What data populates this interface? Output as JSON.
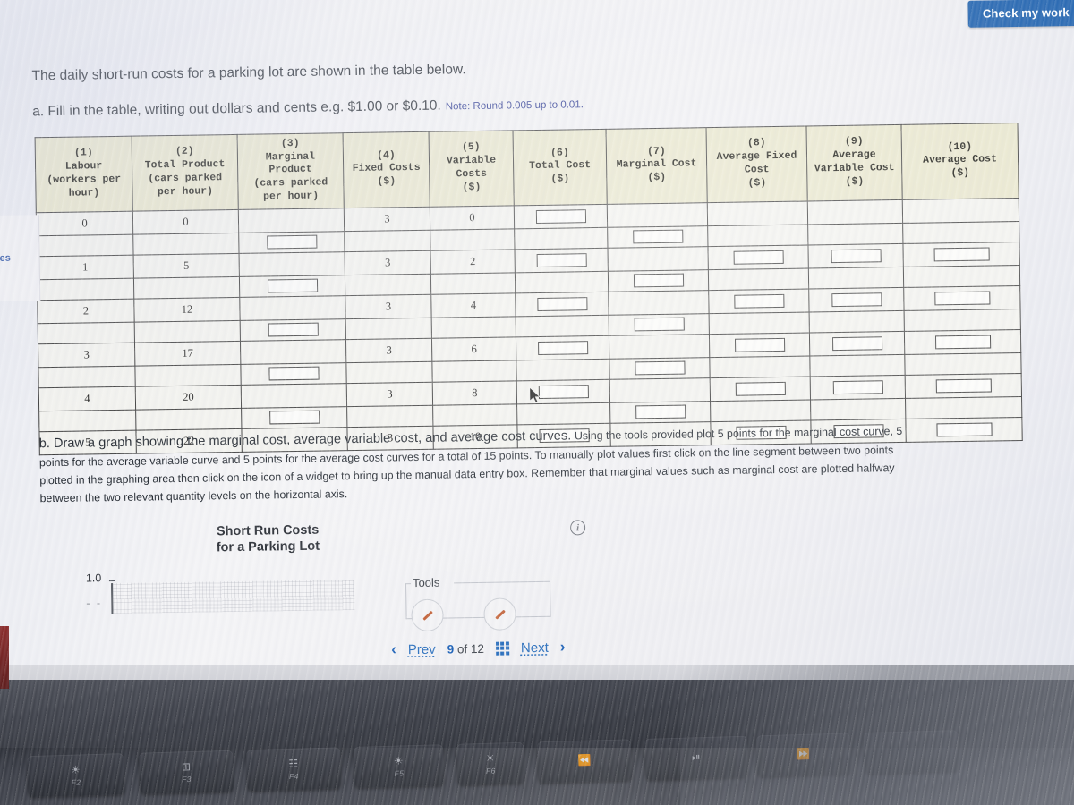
{
  "toolbar": {
    "check_my_work": "Check my work"
  },
  "left_edge_fragment": "es",
  "prompt": {
    "line1": "The daily short-run costs for a parking lot are shown in the table below.",
    "line2": "a.  Fill in the table, writing out dollars and cents e.g. $1.00 or $0.10.",
    "note": "Note: Round 0.005 up to 0.01."
  },
  "table": {
    "headers": [
      {
        "num": "(1)",
        "label": "Labour\n(workers per\nhour)"
      },
      {
        "num": "(2)",
        "label": "Total Product\n(cars parked\nper hour)"
      },
      {
        "num": "(3)",
        "label": "Marginal\nProduct\n(cars parked\nper hour)"
      },
      {
        "num": "(4)",
        "label": "Fixed Costs\n($)"
      },
      {
        "num": "(5)",
        "label": "Variable\nCosts\n($)"
      },
      {
        "num": "(6)",
        "label": "Total Cost\n($)"
      },
      {
        "num": "(7)",
        "label": "Marginal Cost\n($)"
      },
      {
        "num": "(8)",
        "label": "Average Fixed\nCost\n($)"
      },
      {
        "num": "(9)",
        "label": "Average\nVariable Cost\n($)"
      },
      {
        "num": "(10)",
        "label": "Average Cost\n($)"
      }
    ],
    "rows": [
      {
        "labour": "0",
        "total_product": "0",
        "fixed_costs": "3",
        "variable_costs": "0"
      },
      {
        "labour": "1",
        "total_product": "5",
        "fixed_costs": "3",
        "variable_costs": "2"
      },
      {
        "labour": "2",
        "total_product": "12",
        "fixed_costs": "3",
        "variable_costs": "4"
      },
      {
        "labour": "3",
        "total_product": "17",
        "fixed_costs": "3",
        "variable_costs": "6"
      },
      {
        "labour": "4",
        "total_product": "20",
        "fixed_costs": "3",
        "variable_costs": "8"
      },
      {
        "labour": "5",
        "total_product": "22",
        "fixed_costs": "3",
        "variable_costs": "10"
      }
    ],
    "marginal_product_inputs": [
      "",
      "",
      "",
      "",
      ""
    ],
    "total_cost_inputs": [
      "",
      "",
      "",
      "",
      "",
      ""
    ],
    "marginal_cost_inputs": [
      "",
      "",
      "",
      "",
      ""
    ],
    "average_fixed_cost_inputs": [
      "",
      "",
      "",
      "",
      ""
    ],
    "average_variable_cost_inputs": [
      "",
      "",
      "",
      "",
      ""
    ],
    "average_cost_inputs": [
      "",
      "",
      "",
      "",
      ""
    ]
  },
  "part_b": {
    "lead": "b. Draw a graph showing the marginal cost, average variable cost, and average cost curves.",
    "rest": "Using the tools provided plot 5 points for the marginal cost curve, 5 points for the average variable curve and 5 points for the average cost curves for a total of 15 points. To manually plot values first click on the line segment between two points plotted in the graphing area then click on the icon of a widget to bring up the manual data entry box. Remember that marginal values such as marginal cost are plotted halfway between the two relevant quantity levels on the horizontal axis."
  },
  "graph": {
    "title_line1": "Short Run Costs",
    "title_line2": "for a Parking Lot",
    "y_top_label": "1.0",
    "y_next_label": "- -",
    "info_glyph": "i",
    "tools_label": "Tools"
  },
  "pager": {
    "prev": "Prev",
    "page_current": "9",
    "page_of": "of",
    "page_total": "12",
    "next": "Next"
  },
  "keyboard": {
    "keys": [
      {
        "glyph": "☀",
        "fn": "F2"
      },
      {
        "glyph": "⊞",
        "fn": "F3"
      },
      {
        "glyph": "☷",
        "fn": "F4"
      },
      {
        "glyph": "☀",
        "fn": "F5"
      },
      {
        "glyph": "☀",
        "fn": "F6"
      },
      {
        "glyph": "⏪",
        "fn": ""
      },
      {
        "glyph": "⏯",
        "fn": ""
      },
      {
        "glyph": "⏩",
        "fn": ""
      },
      {
        "glyph": "",
        "fn": ""
      }
    ]
  },
  "colors": {
    "accent_blue": "#1b5fad",
    "header_beige": "#e8e6cc",
    "page_bg": "#e9eaef",
    "link_blue": "#2a6fbd"
  }
}
